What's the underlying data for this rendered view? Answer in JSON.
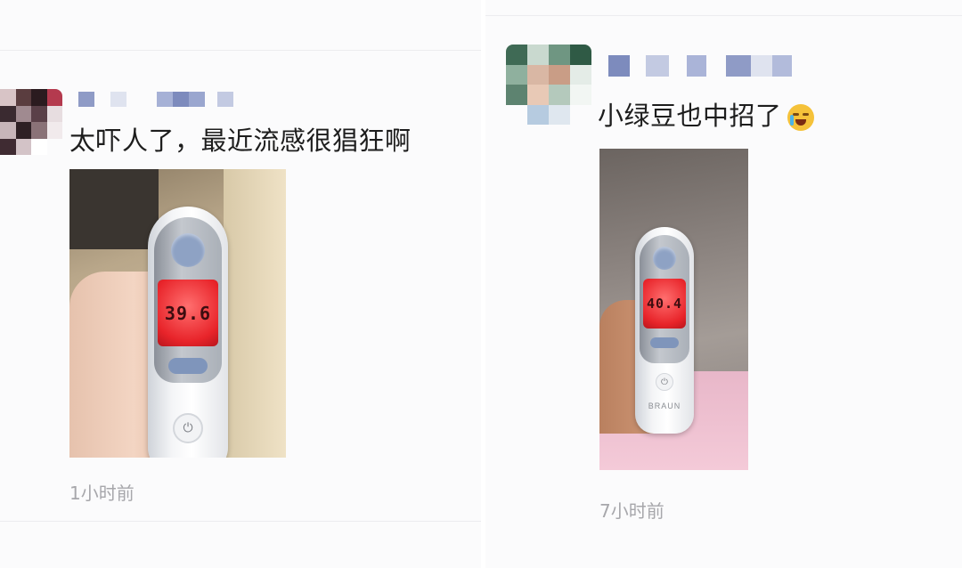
{
  "posts": [
    {
      "text": "太吓人了，最近流感很猖狂啊",
      "time": "1小时前",
      "thermometer_reading": "39.6",
      "thermometer_brand": ""
    },
    {
      "text": "小绿豆也中招了",
      "emoji": "crying-face-emoji",
      "time": "7小时前",
      "thermometer_reading": "40.4",
      "thermometer_brand": "BRAUN"
    }
  ],
  "colors": {
    "panel_bg": "#fbfbfc",
    "text": "#1d1d1d",
    "time": "#a7a7ab",
    "lcd_red": "#e8242a",
    "button_blue": "#8ea2c4"
  }
}
